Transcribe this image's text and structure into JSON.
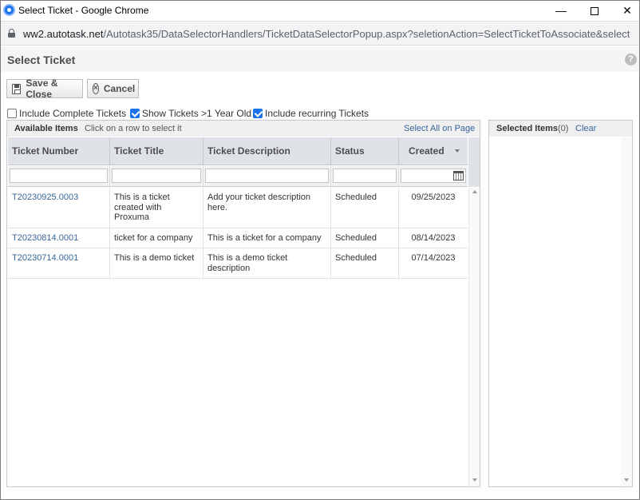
{
  "window": {
    "title": "Select Ticket - Google Chrome",
    "minimize": "—",
    "close": "✕"
  },
  "urlbar": {
    "host": "ww2.autotask.net",
    "path": "/Autotask35/DataSelectorHandlers/TicketDataSelectorPopup.aspx?seletionAction=SelectTicketToAssociate&selection..."
  },
  "page": {
    "title": "Select Ticket",
    "help": "?"
  },
  "toolbar": {
    "save_label": "Save & Close",
    "cancel_label": "Cancel"
  },
  "filters": {
    "include_complete": {
      "label": "Include Complete Tickets",
      "checked": false
    },
    "show_old": {
      "label": "Show Tickets >1 Year Old",
      "checked": true
    },
    "include_recurring": {
      "label": "Include recurring Tickets",
      "checked": true
    }
  },
  "available": {
    "title": "Available Items",
    "hint": "Click on a row to select it",
    "select_all": "Select All on Page",
    "columns": [
      "Ticket Number",
      "Ticket Title",
      "Ticket Description",
      "Status",
      "Created"
    ],
    "rows": [
      {
        "number": "T20230925.0003",
        "title": "This is a ticket created with Proxuma",
        "description": "Add your ticket description here.",
        "status": "Scheduled",
        "created": "09/25/2023"
      },
      {
        "number": "T20230814.0001",
        "title": "ticket for a company",
        "description": "This is a ticket for a company",
        "status": "Scheduled",
        "created": "08/14/2023"
      },
      {
        "number": "T20230714.0001",
        "title": "This is a demo ticket",
        "description": "This is a demo ticket description",
        "status": "Scheduled",
        "created": "07/14/2023"
      }
    ]
  },
  "selected": {
    "title": "Selected Items",
    "count": "(0)",
    "clear": "Clear"
  }
}
